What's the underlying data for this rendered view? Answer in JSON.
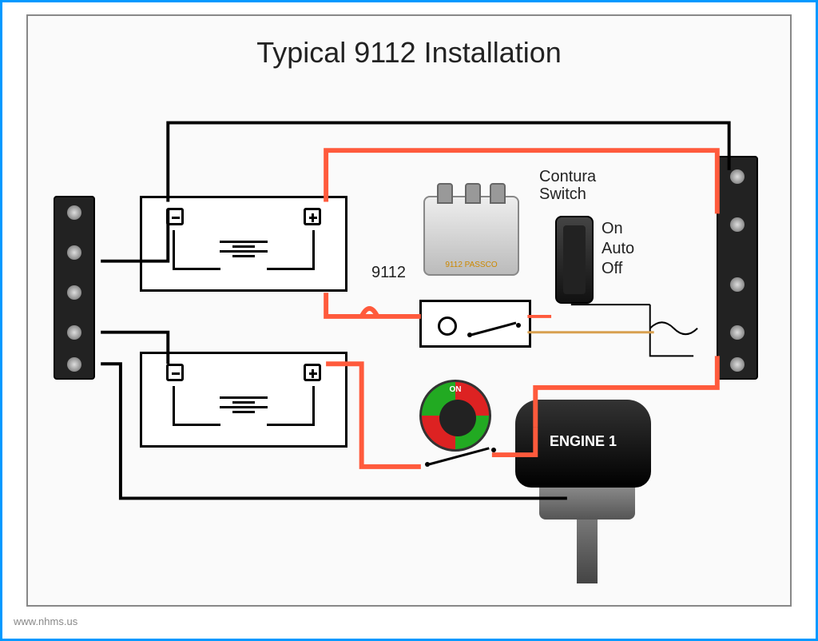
{
  "title": "Typical 9112 Installation",
  "watermark": "www.nhms.us",
  "labels": {
    "solenoid_id": "9112",
    "contura_title": "Contura\nSwitch",
    "contura_on": "On",
    "contura_auto": "Auto",
    "contura_off": "Off",
    "rotary_on": "ON",
    "engine": "ENGINE 1",
    "solenoid_small": "9112 PASSCO"
  },
  "components": {
    "busbars": [
      "negative-busbar-left",
      "positive-busbar-right"
    ],
    "batteries": 2,
    "solenoid_model": "9112",
    "switch_type": "Contura",
    "rotary_switch": true,
    "engine_count": 1
  },
  "wire_colors": {
    "positive": "#ff5a3c",
    "negative": "#000000",
    "signal": "#d8a050"
  }
}
